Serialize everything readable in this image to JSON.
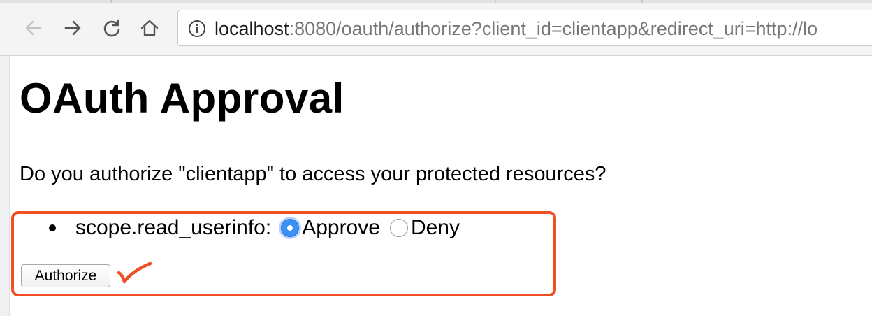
{
  "browser": {
    "url_host": "localhost",
    "url_rest": ":8080/oauth/authorize?client_id=clientapp&redirect_uri=http://lo",
    "icons": {
      "back": "back-arrow-icon",
      "forward": "forward-arrow-icon",
      "reload": "reload-icon",
      "home": "home-icon",
      "info": "info-icon"
    }
  },
  "page": {
    "title": "OAuth Approval",
    "question": "Do you authorize \"clientapp\" to access your protected resources?",
    "scope": {
      "label": "scope.read_userinfo:",
      "options": [
        "Approve",
        "Deny"
      ],
      "selected": "Approve"
    },
    "authorize_label": "Authorize"
  },
  "annotation": {
    "color": "#ef5023",
    "mark": "checkmark"
  },
  "colors": {
    "radio_selected": "#3b8ff5",
    "annotation_red": "#ef5023"
  }
}
